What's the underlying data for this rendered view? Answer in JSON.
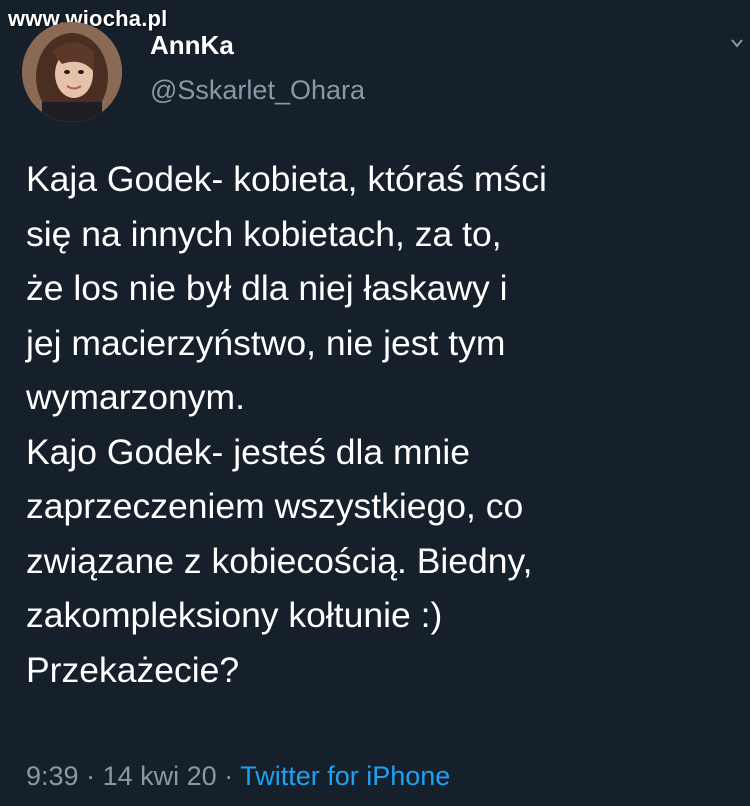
{
  "watermark": "www.wiocha.pl",
  "author": {
    "display_name": "AnnKa",
    "handle": "@Sskarlet_Ohara"
  },
  "tweet": {
    "lines": [
      "Kaja Godek- kobieta, któraś mści",
      "się na innych kobietach, za to,",
      "że los nie był dla niej łaskawy i",
      "jej macierzyństwo, nie jest tym",
      "wymarzonym.",
      "Kajo Godek- jesteś dla mnie",
      "zaprzeczeniem wszystkiego, co",
      "związane z kobiecością. Biedny,",
      "zakompleksiony kołtunie :)",
      "Przekażecie?"
    ]
  },
  "meta": {
    "time": "9:39",
    "separator": "·",
    "date": "14 kwi 20",
    "source": "Twitter for iPhone"
  },
  "colors": {
    "background": "#15202b",
    "secondary_text": "#8899a6",
    "link": "#1da1f2"
  },
  "icons": {
    "more": "chevron-down-icon"
  }
}
